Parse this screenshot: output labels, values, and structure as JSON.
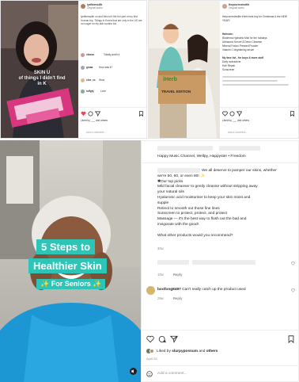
{
  "tl": {
    "overlay_text": "SKIN U\nof things I didn't find\nin K",
    "header_name": "lysfitnesslife",
    "header_meta": "Original audio",
    "caption": "lysfitnesslife on and this isn't the fun part of my first Korean trip. Things in Korea that are only in the US are no longer on my skin routine list.",
    "comment_1_user": "vibexo",
    "comment_1_text": "Totally worth it",
    "comment_2_user": "ginaa",
    "comment_2_text": "How was it?",
    "comment_3_user": "cloe_cc",
    "comment_3_text": "Wow",
    "comment_4_user": "sdfghj",
    "comment_4_text": "Love",
    "likes": "Liked by ___ and others",
    "add_comment": "Add a comment..."
  },
  "tr": {
    "header_name": "theyourreviewlife",
    "header_meta": "Original audio",
    "box_brand": "iHerb",
    "box_text_1": "TRAVEL EDITION",
    "caption": "theyourreviewlife iHerb best buy for Christmas & the NEW YEAR!",
    "list_intro": "Haircare:",
    "list_items": [
      "Bioderma Hydrabio Mist for the holidays",
      "Ultrasonic Serum & Detox Cleanser",
      "Mineral Fusion Pressed Powder",
      "Vitamin C brightening serum"
    ],
    "list_intro_2": "My fave list - for boys & more stuff",
    "list_items_2": [
      "Daily moisturizer",
      "Hair Repair",
      "Sunscreen"
    ],
    "likes": "Liked by ___ and others",
    "add_comment": "Add a comment..."
  },
  "bl": {
    "title_line_1": "5 Steps to",
    "title_line_2": "Healthier Skin",
    "subtitle": "✨ For Seniors ✨"
  },
  "br": {
    "music": "Happy Music Channel, Wellpy, Happyster • Freedom",
    "caption_lines": [
      "We all deserve to pamper our skins, whether",
      "we're 50, 60, or even 80! ✨",
      "✱Our top picks",
      "Mild facial cleanser to gently cleanse without stripping away",
      "your natural oils",
      "Hyaluronic acid moisturiser to keep your skin moist and",
      "supple",
      "Retinol to smooth out those fine lines",
      "Sunscreen to protect, protect, and protect",
      "Massage — it's the best way to flush out the bad and",
      "invigorate with the good!",
      "",
      "What other products would you recommend?"
    ],
    "caption_age": "30w",
    "reply_age": "10w",
    "reply_label": "Reply",
    "comment_user": "boofong8497",
    "comment_text": "Can't really catch up the product used",
    "comment_age": "29w",
    "comment_reply": "Reply",
    "liked_prefix": "Liked by",
    "liked_user": "slurpypossum",
    "liked_mid": "and",
    "liked_others": "others",
    "date": "April 25",
    "add_comment": "Add a comment..."
  },
  "colors": {
    "teal": "#2ec4b6",
    "heart": "#ed4956",
    "like_heart": "#262626"
  }
}
